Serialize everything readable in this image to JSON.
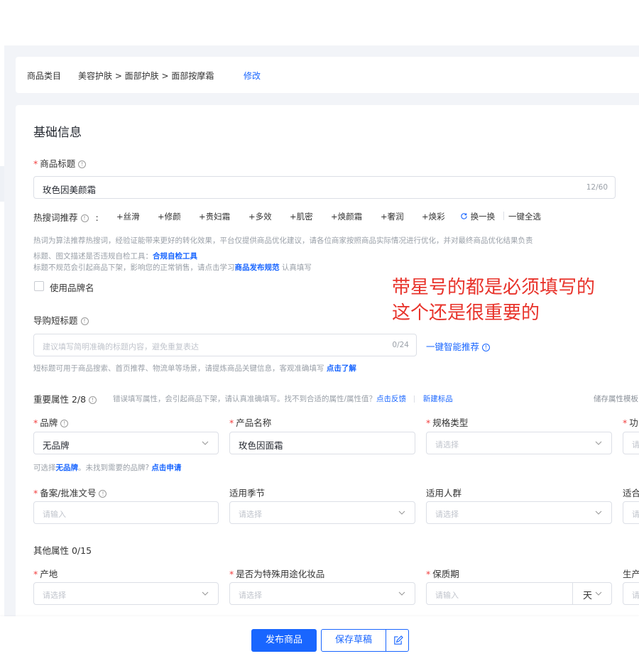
{
  "category": {
    "label": "商品类目",
    "path": "美容护肤 > 面部护肤 > 面部按摩霜",
    "edit_link": "修改"
  },
  "basic_info": {
    "section_title": "基础信息",
    "product_title": {
      "label": "商品标题",
      "value": "玫色因美颜霜",
      "count": "12/60"
    },
    "hot_words": {
      "label": "热搜词推荐",
      "colon": ":",
      "keywords": [
        "+丝滑",
        "+修颜",
        "+贵妇霜",
        "+多效",
        "+肌密",
        "+焕颜霜",
        "+奢润",
        "+焕彩"
      ],
      "refresh": "换一换",
      "select_all": "一键全选",
      "note": "热词为算法推荐热搜词，经验证能带来更好的转化效果，平台仅提供商品优化建议，请各位商家按照商品实际情况进行优化，并对最终商品优化结果负责"
    },
    "check_tool": {
      "prefix": "标题、图文描述是否违规自检工具：",
      "link": "合规自检工具"
    },
    "rules_note": {
      "prefix": "标题不规范会引起商品下架，影响您的正常销售，请点击学习",
      "link": "商品发布规范",
      "suffix": "认真填写"
    },
    "use_brand_name": "使用品牌名",
    "short_title": {
      "label": "导购短标题",
      "placeholder": "建议填写简明准确的标题内容，避免重复表达",
      "count": "0/24",
      "smart_btn": "一键智能推荐",
      "note_prefix": "短标题可用于商品搜索、首页推荐、物流单等场景，请提炼商品关键信息，客观准确填写",
      "note_link": "点击了解"
    }
  },
  "important_attrs": {
    "title": "重要属性 2/8",
    "warning": "错误填写属性，会引起商品下架，请认真准确填写。找不到合适的属性/属性值？",
    "feedback_link": "点击反馈",
    "new_brand_link": "新建标品",
    "save_template": "储存属性模板",
    "brand": {
      "label": "品牌",
      "value": "无品牌"
    },
    "brand_hint": {
      "prefix": "可选择",
      "no_brand": "无品牌",
      "mid": "。未找到需要的品牌?",
      "apply": "点击申请"
    },
    "product_name": {
      "label": "产品名称",
      "value": "玫色因面霜"
    },
    "spec_type": {
      "label": "规格类型",
      "placeholder": "请选择"
    },
    "function": {
      "label": "功",
      "placeholder": "请"
    },
    "record_no": {
      "label": "备案/批准文号",
      "placeholder": "请输入"
    },
    "season": {
      "label": "适用季节",
      "placeholder": "请选择"
    },
    "crowd": {
      "label": "适用人群",
      "placeholder": "请选择"
    },
    "skin": {
      "label": "适合",
      "placeholder": "请"
    }
  },
  "other_attrs": {
    "title": "其他属性 0/15",
    "origin": {
      "label": "产地",
      "placeholder": "请选择"
    },
    "special_use": {
      "label": "是否为特殊用途化妆品",
      "placeholder": "请选择"
    },
    "shelf_life": {
      "label": "保质期",
      "placeholder": "请输入",
      "unit": "天"
    },
    "production": {
      "label": "生产",
      "placeholder": "请"
    }
  },
  "annotation": {
    "line1": "带星号的都是必须填写的",
    "line2": "这个还是很重要的"
  },
  "footer": {
    "publish": "发布商品",
    "save_draft": "保存草稿"
  },
  "colors": {
    "primary": "#1966ff",
    "required": "#f24040",
    "annotation": "#e8332b",
    "background": "#f2f4f8"
  }
}
